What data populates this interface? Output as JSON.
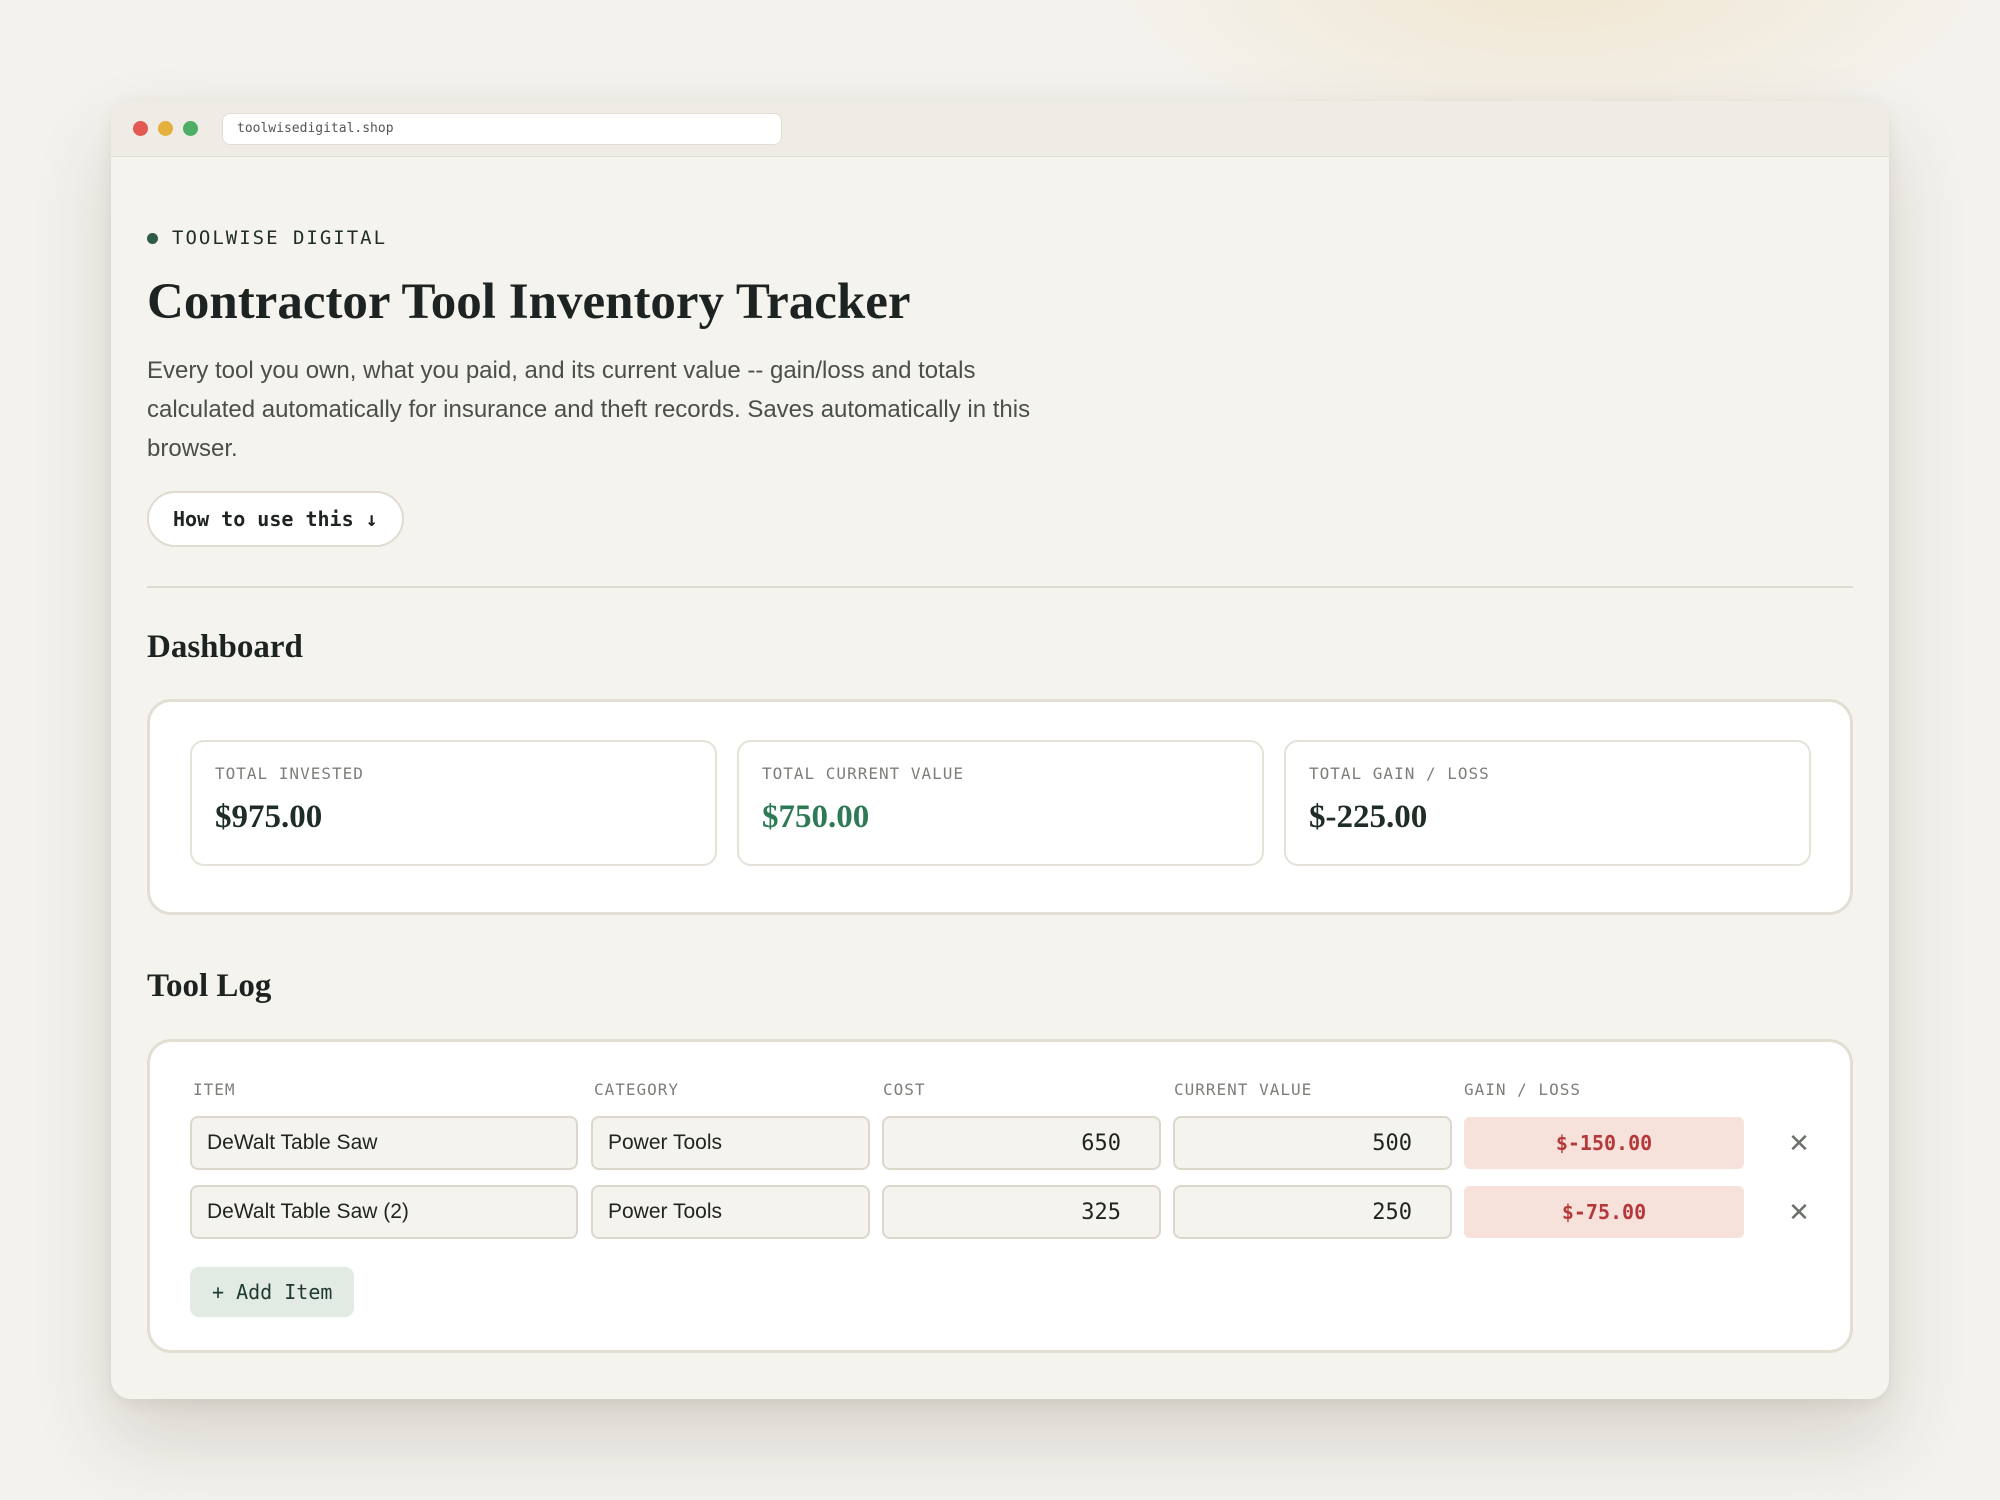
{
  "browser": {
    "url": "toolwisedigital.shop"
  },
  "header": {
    "brand": "TOOLWISE DIGITAL",
    "title": "Contractor Tool Inventory Tracker",
    "description": "Every tool you own, what you paid, and its current value -- gain/loss and totals calculated automatically for insurance and theft records. Saves automatically in this browser.",
    "howto_label": "How to use this ↓"
  },
  "dashboard": {
    "heading": "Dashboard",
    "stats": [
      {
        "label": "TOTAL INVESTED",
        "value": "$975.00"
      },
      {
        "label": "TOTAL CURRENT VALUE",
        "value": "$750.00"
      },
      {
        "label": "TOTAL GAIN / LOSS",
        "value": "$-225.00"
      }
    ]
  },
  "tool_log": {
    "heading": "Tool Log",
    "columns": [
      "ITEM",
      "CATEGORY",
      "COST",
      "CURRENT VALUE",
      "GAIN / LOSS"
    ],
    "rows": [
      {
        "item": "DeWalt Table Saw",
        "category": "Power Tools",
        "cost": "650",
        "current_value": "500",
        "gain_loss": "$-150.00"
      },
      {
        "item": "DeWalt Table Saw (2)",
        "category": "Power Tools",
        "cost": "325",
        "current_value": "250",
        "gain_loss": "$-75.00"
      }
    ],
    "remove_glyph": "✕",
    "add_label": "+ Add Item"
  },
  "colors": {
    "accent_green": "#2f7a56",
    "loss_red": "#b5393a",
    "loss_bg": "#f6e1db"
  }
}
